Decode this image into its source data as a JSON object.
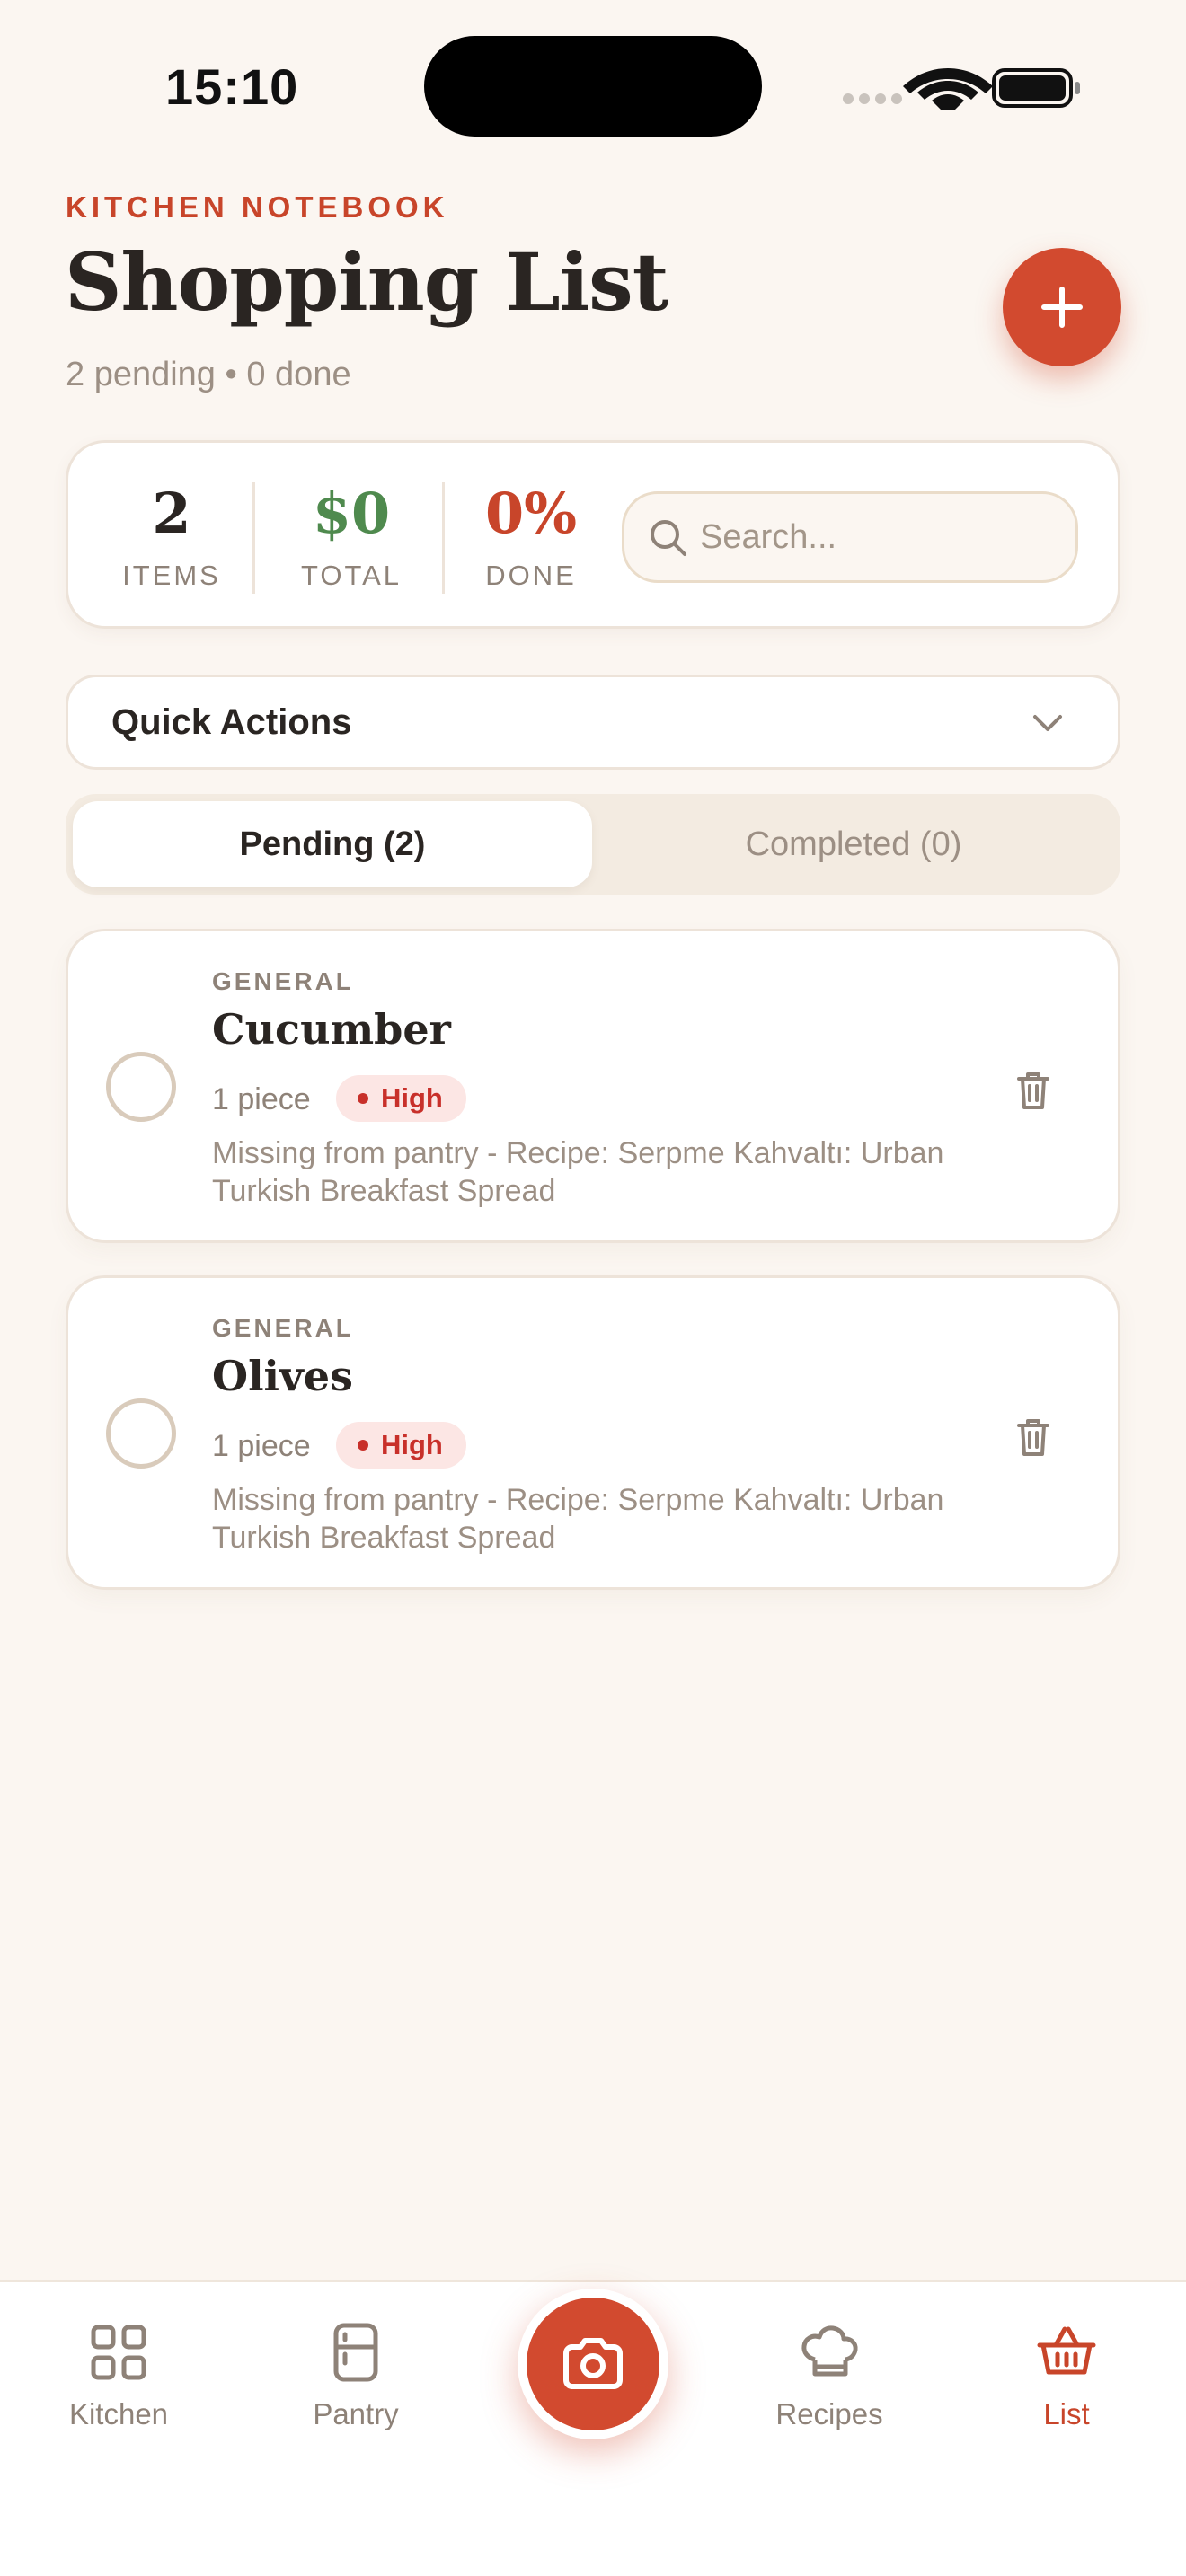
{
  "status_bar": {
    "time": "15:10"
  },
  "header": {
    "eyebrow": "KITCHEN NOTEBOOK",
    "title": "Shopping List",
    "subtitle": "2 pending • 0 done"
  },
  "stats": {
    "items": {
      "value": "2",
      "label": "ITEMS"
    },
    "total": {
      "value": "$0",
      "label": "TOTAL"
    },
    "done": {
      "value": "0%",
      "label": "DONE"
    }
  },
  "search": {
    "placeholder": "Search...",
    "value": ""
  },
  "quick_actions": {
    "label": "Quick Actions"
  },
  "tabs": [
    {
      "label": "Pending (2)",
      "active": true
    },
    {
      "label": "Completed (0)",
      "active": false
    }
  ],
  "items": [
    {
      "category": "GENERAL",
      "name": "Cucumber",
      "quantity": "1 piece",
      "priority": "High",
      "note": "Missing from pantry - Recipe: Serpme Kahvaltı: Urban Turkish Breakfast Spread"
    },
    {
      "category": "GENERAL",
      "name": "Olives",
      "quantity": "1 piece",
      "priority": "High",
      "note": "Missing from pantry - Recipe: Serpme Kahvaltı: Urban Turkish Breakfast Spread"
    }
  ],
  "nav": {
    "kitchen": "Kitchen",
    "pantry": "Pantry",
    "recipes": "Recipes",
    "list": "List"
  },
  "colors": {
    "accent": "#D24A2F",
    "background": "#FBF6F1",
    "total_green": "#4F8A4E",
    "done_red": "#C8452A",
    "priority_high": "#C8302A"
  }
}
